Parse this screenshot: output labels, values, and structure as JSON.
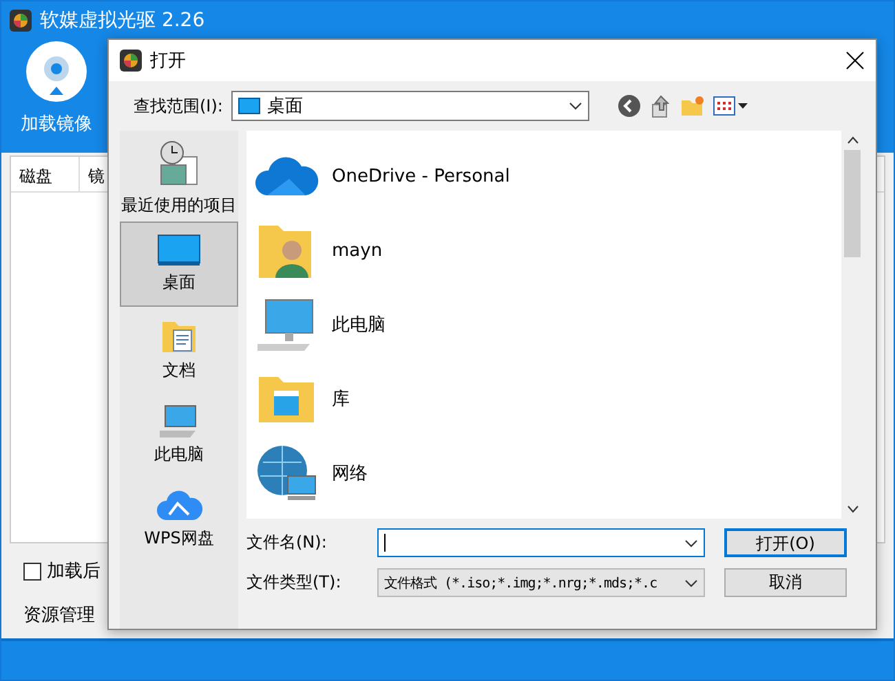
{
  "app": {
    "title": "软媒虚拟光驱 2.26",
    "toolbar_button": "加载镜像",
    "table": {
      "columns": [
        "磁盘",
        "镜"
      ]
    },
    "checkbox": {
      "label": "加载后",
      "checked": false
    },
    "footer_label": "资源管理"
  },
  "dialog": {
    "title": "打开",
    "look_in": {
      "label": "查找范围(I):",
      "value": "桌面"
    },
    "places": [
      {
        "label": "最近使用的项目",
        "kind": "recent",
        "selected": false
      },
      {
        "label": "桌面",
        "kind": "desktop",
        "selected": true
      },
      {
        "label": "文档",
        "kind": "documents",
        "selected": false
      },
      {
        "label": "此电脑",
        "kind": "computer",
        "selected": false
      },
      {
        "label": "WPS网盘",
        "kind": "cloud",
        "selected": false
      }
    ],
    "files": [
      {
        "name": "OneDrive - Personal",
        "kind": "cloud"
      },
      {
        "name": "mayn",
        "kind": "user"
      },
      {
        "name": "此电脑",
        "kind": "computer"
      },
      {
        "name": "库",
        "kind": "library"
      },
      {
        "name": "网络",
        "kind": "network"
      }
    ],
    "file_name": {
      "label": "文件名(N):"
    },
    "file_type": {
      "label": "文件类型(T):",
      "value": "文件格式 (*.iso;*.img;*.nrg;*.mds;*.c"
    },
    "buttons": [
      {
        "label": "打开(O)",
        "default": true
      },
      {
        "label": "取消",
        "default": false
      }
    ]
  }
}
